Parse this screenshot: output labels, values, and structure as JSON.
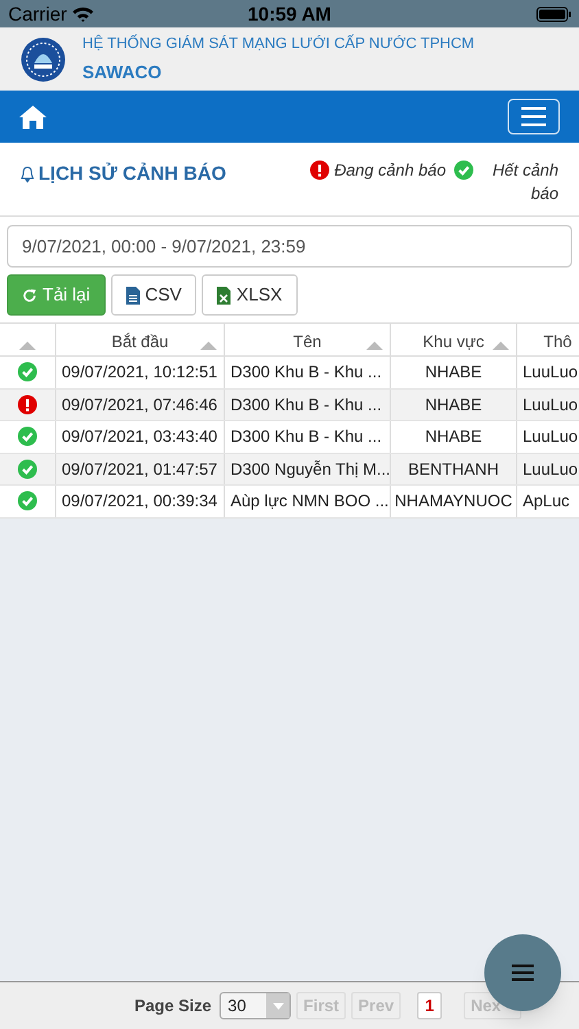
{
  "status_bar": {
    "carrier": "Carrier",
    "time": "10:59 AM"
  },
  "header": {
    "title": "HỆ THỐNG GIÁM SÁT MẠNG LƯỚI CẤP NƯỚC TPHCM",
    "subtitle": "SAWACO"
  },
  "page": {
    "title": "LỊCH SỬ CẢNH BÁO",
    "legend": [
      {
        "kind": "alert",
        "label": "Đang cảnh báo"
      },
      {
        "kind": "ok",
        "label": "Hết cảnh báo"
      }
    ]
  },
  "date_range": {
    "value": "9/07/2021, 00:00 - 9/07/2021, 23:59"
  },
  "buttons": [
    {
      "kind": "reload",
      "label": "Tải lại"
    },
    {
      "kind": "csv",
      "label": "CSV"
    },
    {
      "kind": "xlsx",
      "label": "XLSX"
    }
  ],
  "table": {
    "columns": [
      "Bắt đầu",
      "Tên",
      "Khu vực",
      "Thô"
    ],
    "rows": [
      {
        "kind": "ok",
        "cells": [
          "09/07/2021, 10:12:51",
          "D300 Khu B - Khu ...",
          "NHABE",
          "LuuLuo"
        ]
      },
      {
        "kind": "alert",
        "cells": [
          "09/07/2021, 07:46:46",
          "D300 Khu B - Khu ...",
          "NHABE",
          "LuuLuo"
        ]
      },
      {
        "kind": "ok",
        "cells": [
          "09/07/2021, 03:43:40",
          "D300 Khu B - Khu ...",
          "NHABE",
          "LuuLuo"
        ]
      },
      {
        "kind": "ok",
        "cells": [
          "09/07/2021, 01:47:57",
          "D300 Nguyễn Thị M...",
          "BENTHANH",
          "LuuLuo"
        ]
      },
      {
        "kind": "ok",
        "cells": [
          "09/07/2021, 00:39:34",
          "Aùp lực NMN BOO ...",
          "NHAMAYNUOC",
          "ApLuc"
        ]
      }
    ]
  },
  "pager": {
    "page_size_label": "Page Size",
    "page_size": "30",
    "first": "First",
    "prev": "Prev",
    "page": "1",
    "next": "Nex"
  }
}
